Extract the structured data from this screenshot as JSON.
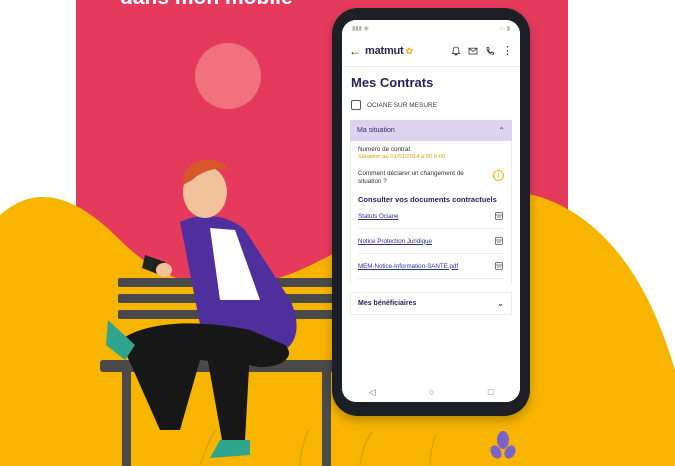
{
  "hero": {
    "headline": "dans mon mobile"
  },
  "colors": {
    "panel": "#e63a5d",
    "accent_yellow": "#f7b500",
    "brand_purple": "#2b1d5a"
  },
  "app": {
    "brand": "matmut",
    "back_icon": "arrow-left-icon",
    "header_icons": [
      "bell-icon",
      "mail-icon",
      "phone-icon",
      "more-vertical-icon"
    ],
    "page_title": "Mes Contrats",
    "contract_name": "OCIANE SUR MESURE",
    "situation": {
      "title": "Ma situation",
      "contract_number_label": "Numéro de contrat",
      "contract_number_value": "Situation au 01/01/2014 à 00 h 00",
      "declare_change_label": "Comment déclarer un changement de situation ?"
    },
    "documents": {
      "title": "Consulter vos documents contractuels",
      "items": [
        {
          "label": "Statuts Ociane"
        },
        {
          "label": "Notice Protection Juridique"
        },
        {
          "label": "MEM-Notice-Information-SANTE.pdf"
        }
      ]
    },
    "beneficiaries_label": "Mes bénéficiaires",
    "nav": [
      "back-nav-icon",
      "home-nav-icon",
      "recents-nav-icon"
    ]
  }
}
